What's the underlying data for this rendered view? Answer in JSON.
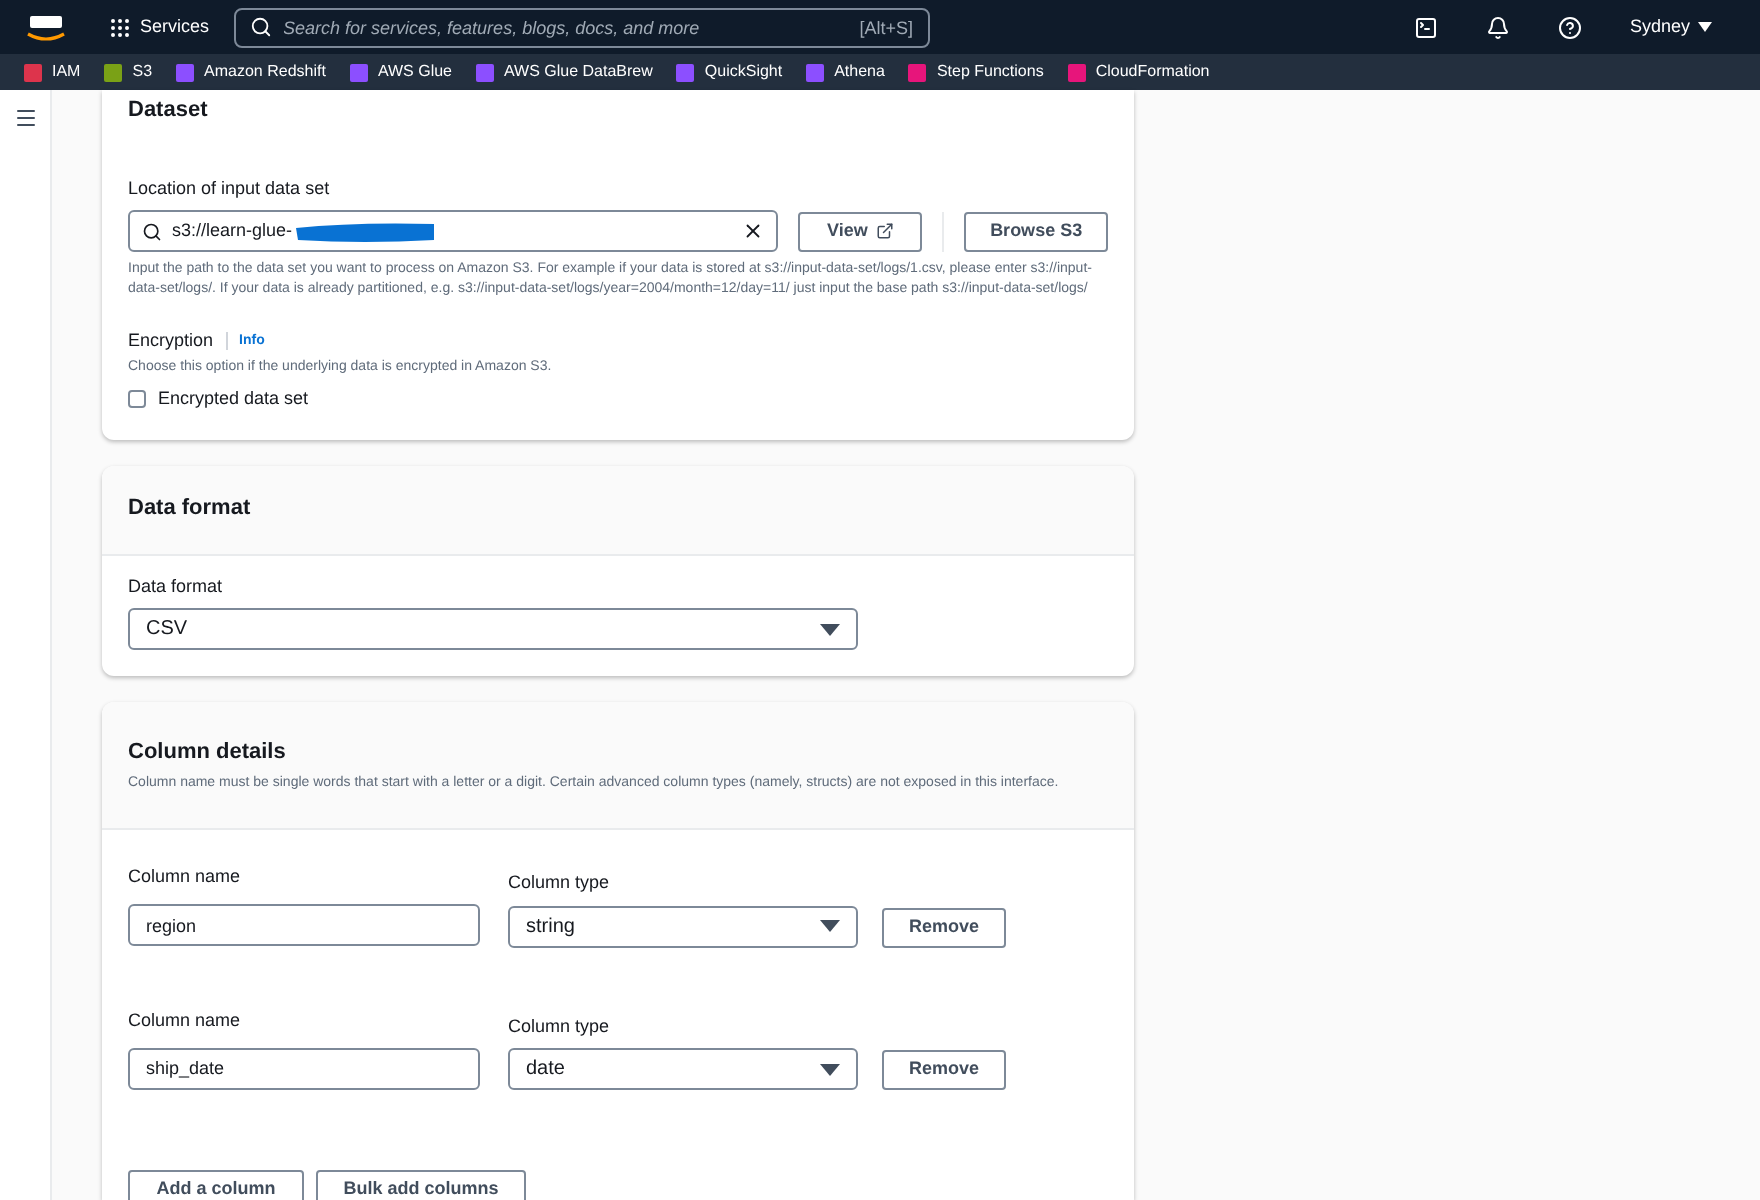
{
  "top_nav": {
    "services_label": "Services",
    "search": {
      "placeholder": "Search for services, features, blogs, docs, and more",
      "shortcut": "[Alt+S]"
    },
    "region": "Sydney"
  },
  "favorites": [
    {
      "label": "IAM",
      "color": "#dd344c"
    },
    {
      "label": "S3",
      "color": "#7aa116"
    },
    {
      "label": "Amazon Redshift",
      "color": "#8c4fff"
    },
    {
      "label": "AWS Glue",
      "color": "#8c4fff"
    },
    {
      "label": "AWS Glue DataBrew",
      "color": "#8c4fff"
    },
    {
      "label": "QuickSight",
      "color": "#8c4fff"
    },
    {
      "label": "Athena",
      "color": "#8c4fff"
    },
    {
      "label": "Step Functions",
      "color": "#e7157b"
    },
    {
      "label": "CloudFormation",
      "color": "#e7157b"
    }
  ],
  "dataset": {
    "title": "Dataset",
    "location_label": "Location of input data set",
    "location_value": "s3://learn-glue-",
    "view_button": "View",
    "browse_button": "Browse S3",
    "hint": "Input the path to the data set you want to process on Amazon S3. For example if your data is stored at s3://input-data-set/logs/1.csv, please enter s3://input-data-set/logs/. If your data is already partitioned, e.g. s3://input-data-set/logs/year=2004/month=12/day=11/ just input the base path s3://input-data-set/logs/",
    "encryption_label": "Encryption",
    "info_link": "Info",
    "encryption_hint": "Choose this option if the underlying data is encrypted in Amazon S3.",
    "encrypted": {
      "label": "Encrypted data set",
      "checked": false
    }
  },
  "data_format": {
    "title": "Data format",
    "label": "Data format",
    "value": "CSV"
  },
  "column_details": {
    "title": "Column details",
    "description": "Column name must be single words that start with a letter or a digit. Certain advanced column types (namely, structs) are not exposed in this interface.",
    "columns": [
      {
        "name_label": "Column name",
        "name": "region",
        "type_label": "Column type",
        "type": "string",
        "remove": "Remove"
      },
      {
        "name_label": "Column name",
        "name": "ship_date",
        "type_label": "Column type",
        "type": "date",
        "remove": "Remove"
      }
    ],
    "add_button": "Add a column",
    "bulk_button": "Bulk add columns"
  }
}
